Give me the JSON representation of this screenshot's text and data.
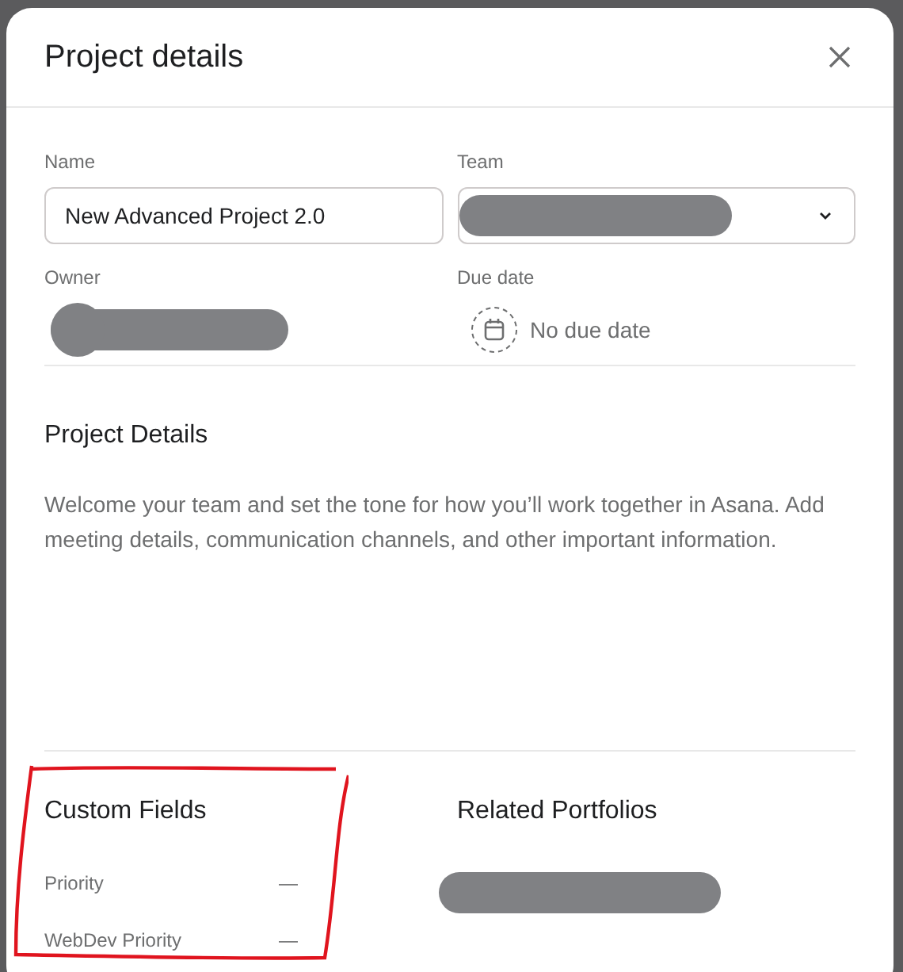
{
  "dialog": {
    "title": "Project details"
  },
  "name_field": {
    "label": "Name",
    "value": "New Advanced Project 2.0"
  },
  "team_field": {
    "label": "Team"
  },
  "owner": {
    "label": "Owner"
  },
  "due_date": {
    "label": "Due date",
    "value": "No due date"
  },
  "project_details": {
    "heading": "Project Details",
    "text": "Welcome your team and set the tone for how you’ll work together in Asana. Add meeting details, communication channels, and other important information."
  },
  "custom_fields": {
    "title": "Custom Fields",
    "items": [
      {
        "label": "Priority",
        "value": "—"
      },
      {
        "label": "WebDev Priority",
        "value": "—"
      }
    ]
  },
  "related_portfolios": {
    "title": "Related Portfolios"
  }
}
